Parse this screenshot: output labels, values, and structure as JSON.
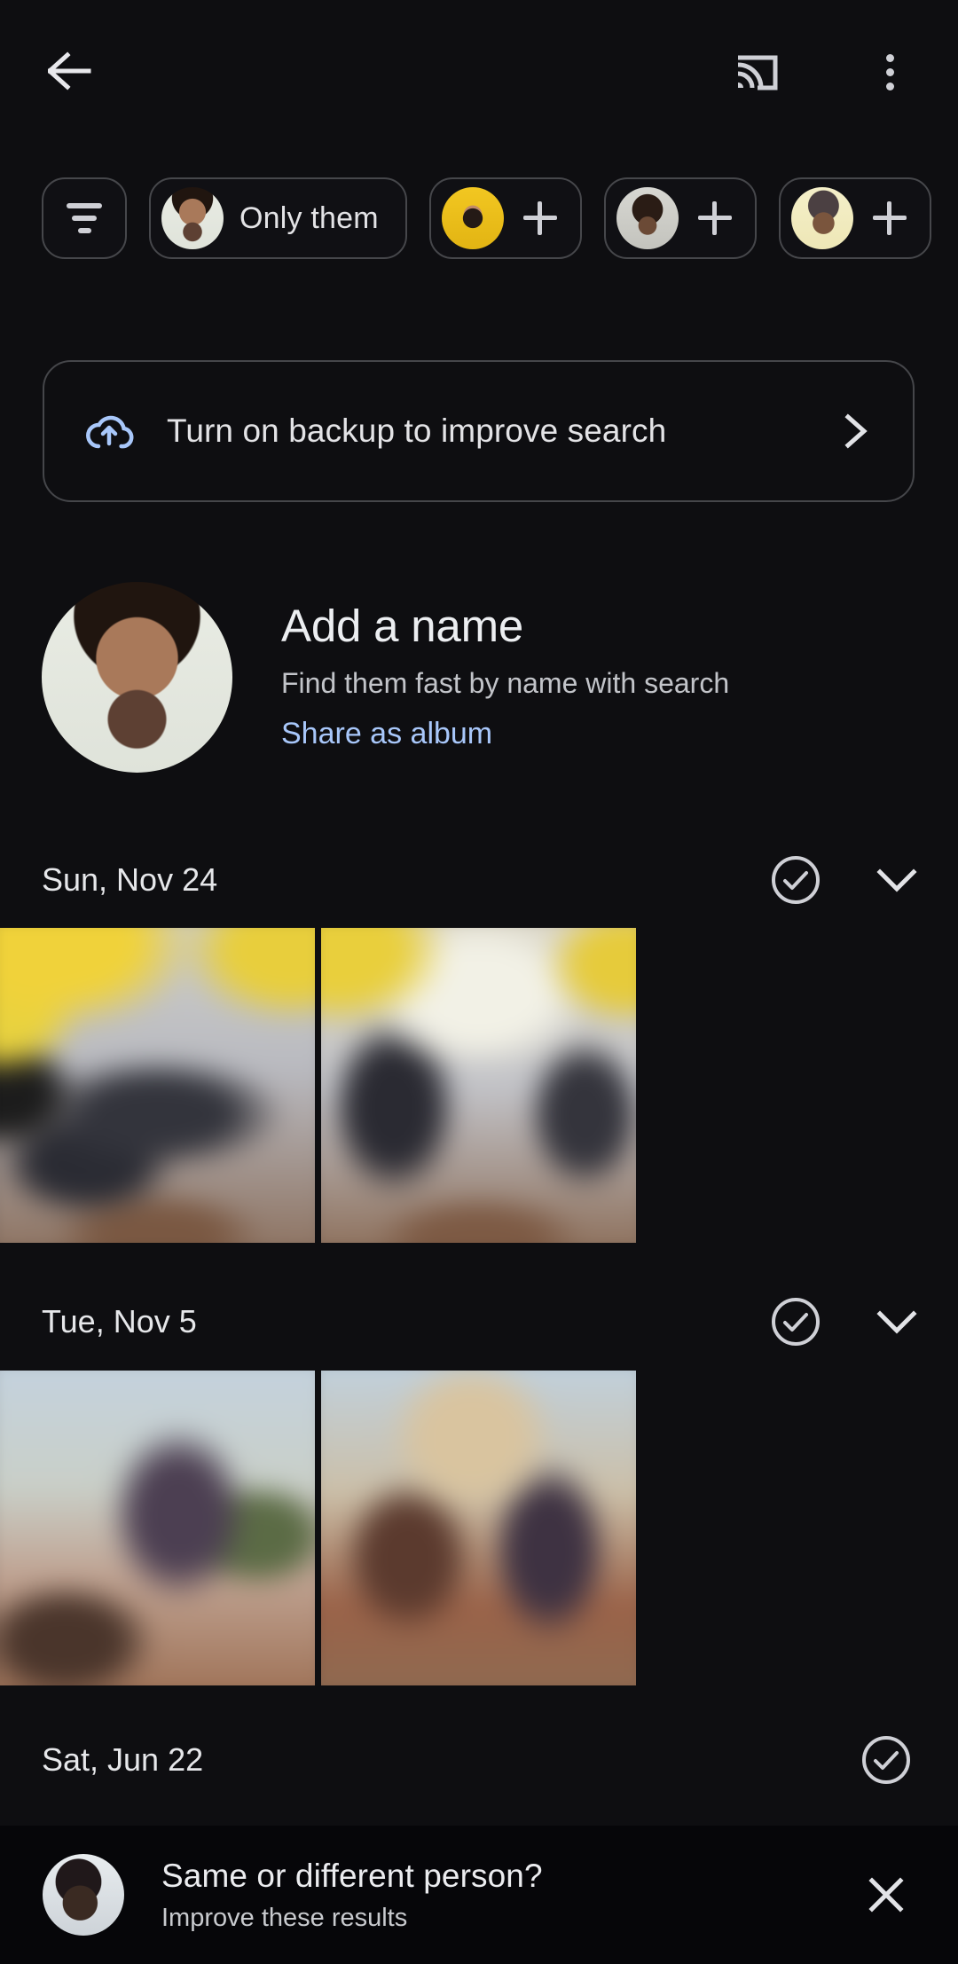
{
  "appbar": {
    "back_icon": "arrow-back-icon",
    "cast_icon": "cast-icon",
    "overflow_icon": "more-vert-icon"
  },
  "chips": [
    {
      "id": "filter",
      "icon": "filter-list-icon",
      "label": "",
      "type": "icon-only",
      "avatar": ""
    },
    {
      "id": "only-them",
      "icon": "",
      "label": "Only them",
      "type": "person-label",
      "avatar": "face-a"
    },
    {
      "id": "add-person-1",
      "icon": "plus-icon",
      "label": "",
      "type": "person-plus",
      "avatar": "face-b"
    },
    {
      "id": "add-person-2",
      "icon": "plus-icon",
      "label": "",
      "type": "person-plus",
      "avatar": "face-c"
    },
    {
      "id": "add-person-3",
      "icon": "plus-icon",
      "label": "",
      "type": "person-plus",
      "avatar": "face-d"
    }
  ],
  "banner": {
    "icon": "cloud-upload-icon",
    "text": "Turn on backup to improve search",
    "chevron": "chevron-right-icon",
    "icon_color": "#a8c7fa"
  },
  "person": {
    "avatar": "face-a",
    "title": "Add a name",
    "subtitle": "Find them fast by name with search",
    "link": "Share as album",
    "link_color": "#a8c7fa"
  },
  "sections": [
    {
      "date": "Sun, Nov 24",
      "select_icon": "check-circle-icon",
      "expand_icon": "chevron-down-icon",
      "has_expand": true,
      "photos": [
        {
          "name": "photo-party-1",
          "style": "ph-party1"
        },
        {
          "name": "photo-party-2",
          "style": "ph-party2"
        }
      ]
    },
    {
      "date": "Tue, Nov 5",
      "select_icon": "check-circle-icon",
      "expand_icon": "chevron-down-icon",
      "has_expand": true,
      "photos": [
        {
          "name": "photo-outdoor-1",
          "style": "ph-out1"
        },
        {
          "name": "photo-outdoor-2",
          "style": "ph-out2"
        }
      ]
    },
    {
      "date": "Sat, Jun 22",
      "select_icon": "check-circle-icon",
      "expand_icon": "",
      "has_expand": false,
      "photos": []
    }
  ],
  "bottom_sheet": {
    "avatar": "face-e",
    "title": "Same or different person?",
    "subtitle": "Improve these results",
    "close_icon": "close-icon"
  },
  "colors": {
    "background": "#0e0e11",
    "sheet_background": "#060609",
    "accent_blue": "#a8c7fa",
    "text_primary": "#e3e3e6",
    "text_secondary": "#c2c4c9",
    "outline": "#46474b"
  }
}
